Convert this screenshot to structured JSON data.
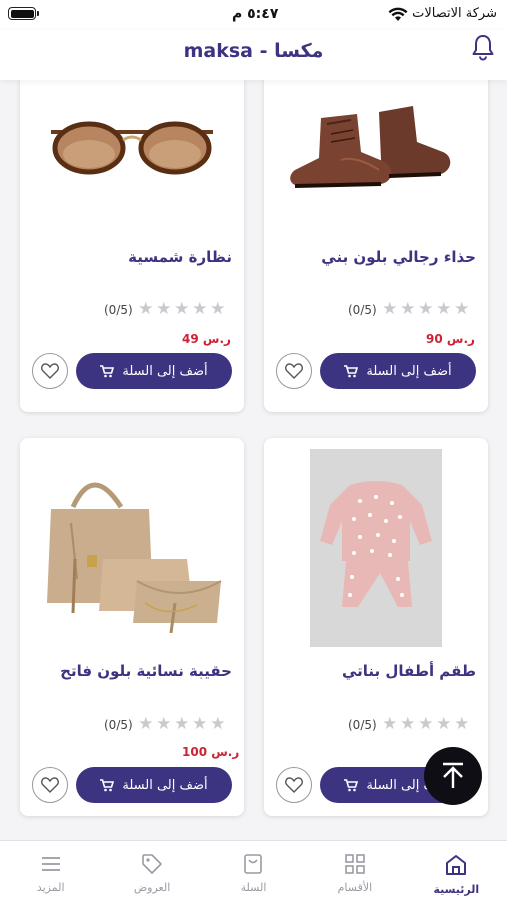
{
  "status_bar": {
    "time": "٥:٤٧ م",
    "carrier": "شركة الاتصالات"
  },
  "header": {
    "title": "maksa - مكسا"
  },
  "products": [
    {
      "name": "حذاء رجالي بلون بني",
      "rating_count": "(0/5)",
      "price": "90 ر.س",
      "add_label": "أضف إلى السلة",
      "image": "brown-shoe"
    },
    {
      "name": "نظارة شمسية",
      "rating_count": "(0/5)",
      "price": "49 ر.س",
      "add_label": "أضف إلى السلة",
      "image": "sunglasses"
    },
    {
      "name": "طقم أطفال بناتي",
      "rating_count": "(0/5)",
      "price": "",
      "add_label": "أضف إلى السلة",
      "image": "kids-set"
    },
    {
      "name": "حقيبة نسائية بلون فاتح",
      "rating_count": "(0/5)",
      "price": "100 ر.س",
      "add_label": "أضف إلى السلة",
      "image": "handbag-set"
    }
  ],
  "tabbar": {
    "items": [
      {
        "label": "الرئيسية",
        "icon": "home-icon",
        "active": true
      },
      {
        "label": "الأقسام",
        "icon": "grid-icon",
        "active": false
      },
      {
        "label": "السلة",
        "icon": "bag-icon",
        "active": false
      },
      {
        "label": "العروض",
        "icon": "tag-icon",
        "active": false
      },
      {
        "label": "المزيد",
        "icon": "menu-icon",
        "active": false
      }
    ]
  },
  "colors": {
    "primary": "#3d3481",
    "price": "#cc2233",
    "star_empty": "#c9c9cf"
  }
}
